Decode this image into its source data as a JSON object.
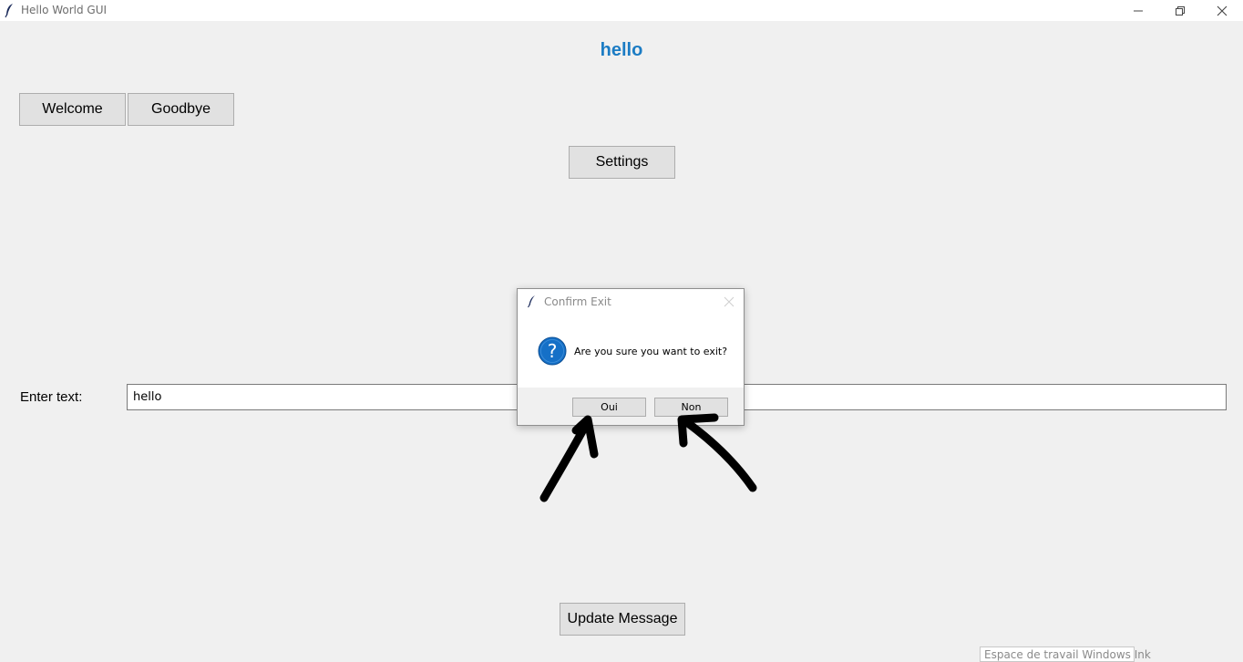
{
  "window": {
    "title": "Hello World GUI",
    "controls": [
      "minimize-icon",
      "restore-icon",
      "close-icon"
    ]
  },
  "main": {
    "heading": "hello",
    "welcome_label": "Welcome",
    "goodbye_label": "Goodbye",
    "settings_label": "Settings",
    "enter_text_label": "Enter text:",
    "entry_value": "hello",
    "update_label": "Update Message"
  },
  "dialog": {
    "title": "Confirm Exit",
    "message": "Are you sure you want to exit?",
    "icon": "question-icon",
    "yes_label": "Oui",
    "no_label": "Non"
  },
  "ink_workspace": "Espace de travail Windows Ink",
  "colors": {
    "heading": "#1c7cc4",
    "question_icon": "#1570c7",
    "background": "#f0f0f0"
  }
}
